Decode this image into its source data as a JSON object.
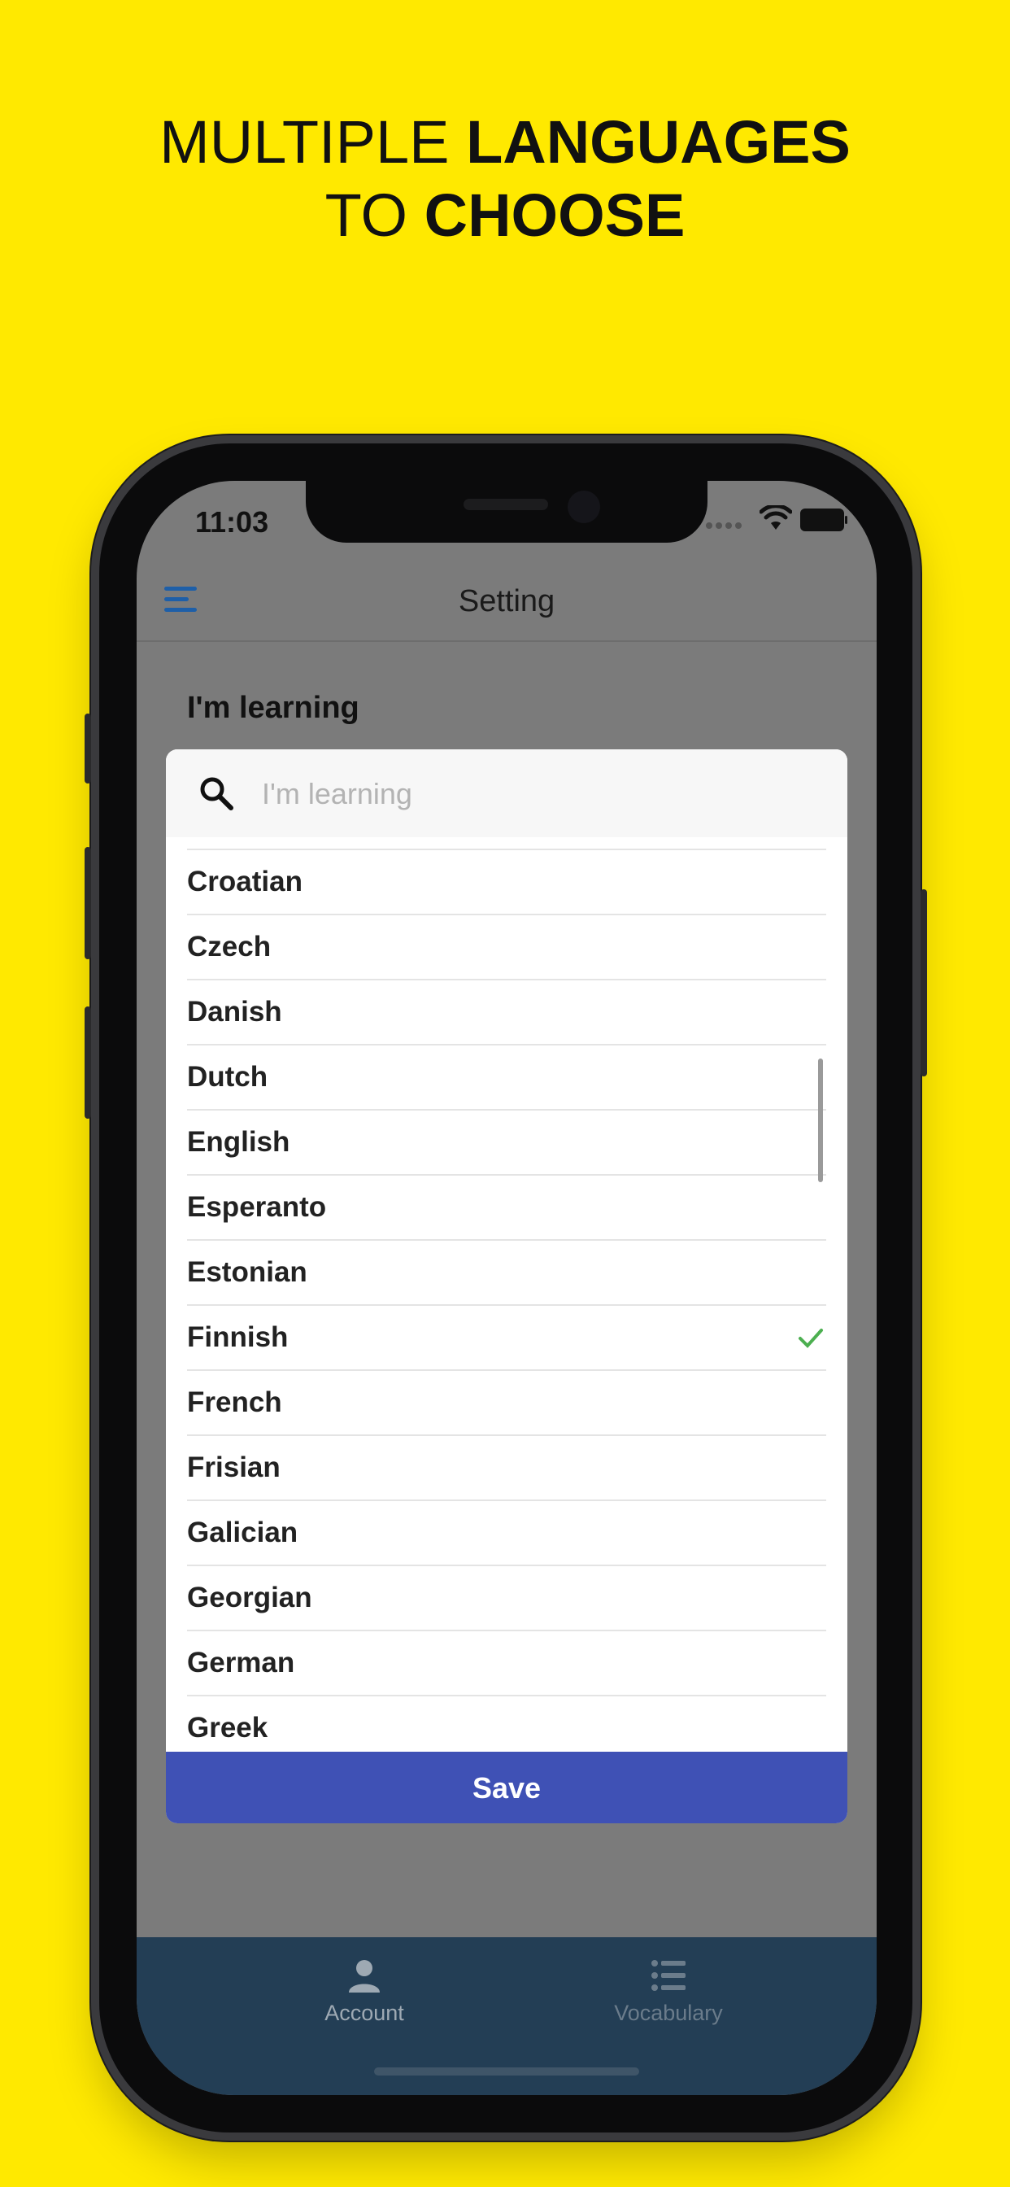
{
  "headline": {
    "line1_regular": "MULTIPLE",
    "line1_bold": "LANGUAGES",
    "line2_regular": "TO",
    "line2_bold": "CHOOSE"
  },
  "status_bar": {
    "time": "11:03"
  },
  "nav": {
    "title": "Setting"
  },
  "section_label": "I'm learning",
  "search": {
    "placeholder": "I'm learning",
    "value": ""
  },
  "languages": [
    {
      "label": "Croatian",
      "selected": false
    },
    {
      "label": "Croatian",
      "selected": false
    },
    {
      "label": "Czech",
      "selected": false
    },
    {
      "label": "Danish",
      "selected": false
    },
    {
      "label": "Dutch",
      "selected": false
    },
    {
      "label": "English",
      "selected": false
    },
    {
      "label": "Esperanto",
      "selected": false
    },
    {
      "label": "Estonian",
      "selected": false
    },
    {
      "label": "Finnish",
      "selected": true
    },
    {
      "label": "French",
      "selected": false
    },
    {
      "label": "Frisian",
      "selected": false
    },
    {
      "label": "Galician",
      "selected": false
    },
    {
      "label": "Georgian",
      "selected": false
    },
    {
      "label": "German",
      "selected": false
    },
    {
      "label": "Greek",
      "selected": false
    }
  ],
  "save_label": "Save",
  "tabs": [
    {
      "label": "Account",
      "icon": "person-icon"
    },
    {
      "label": "Vocabulary",
      "icon": "list-icon"
    }
  ],
  "colors": {
    "background": "#ffe900",
    "save_button": "#3f51b5",
    "tabbar": "#233e55",
    "check": "#4caf50",
    "hamburger": "#1e5fa8",
    "tab_account": "#9ea9b3",
    "tab_vocabulary": "#6b7c8b"
  }
}
